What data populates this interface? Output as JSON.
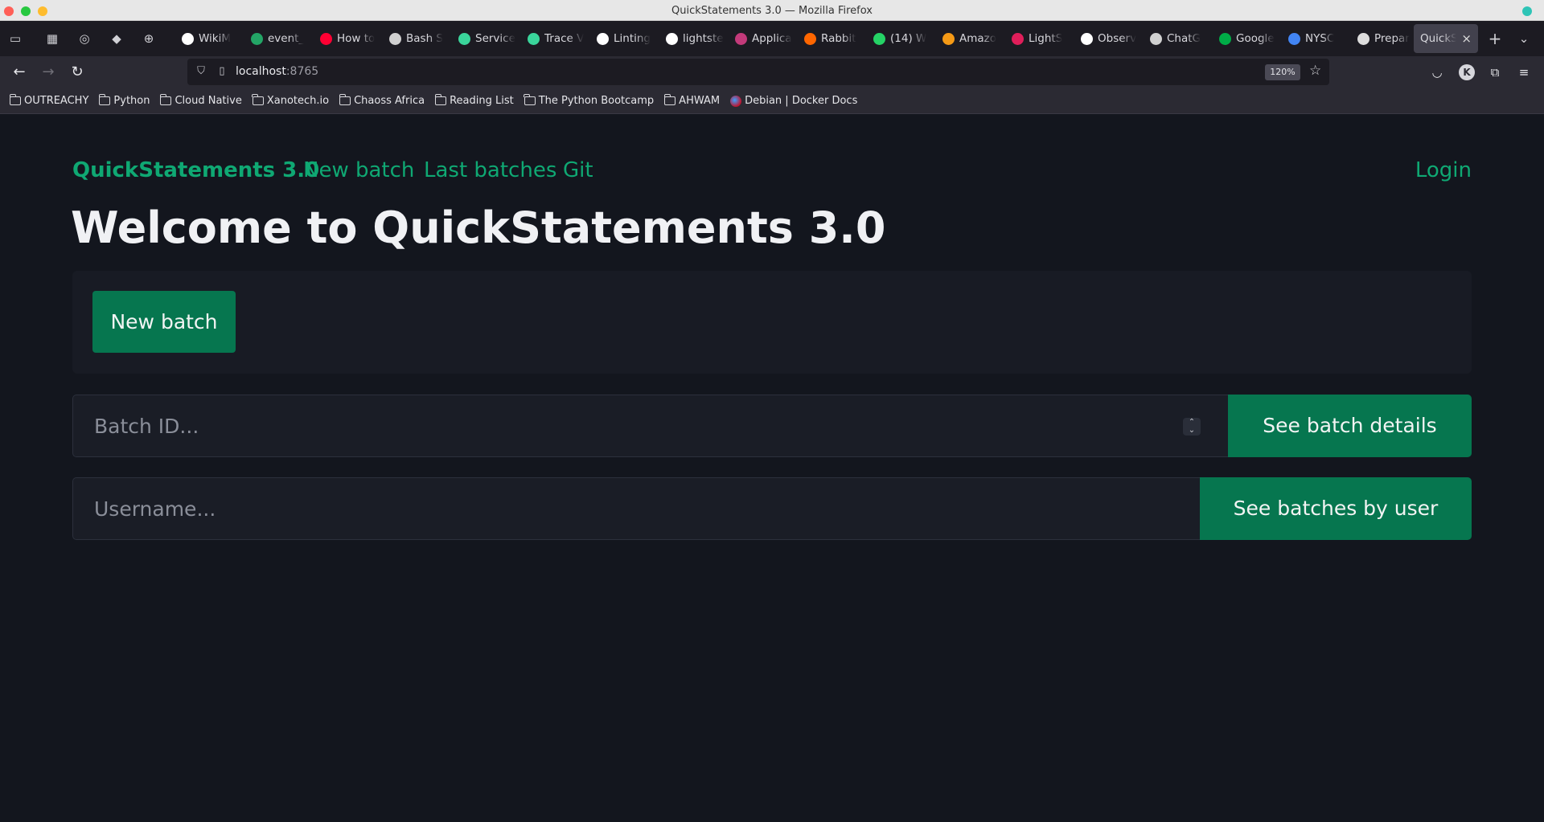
{
  "window": {
    "title": "QuickStatements 3.0 — Mozilla Firefox"
  },
  "tabs": [
    {
      "label": "WikiM",
      "icon": "github-icon",
      "color": "#ffffff"
    },
    {
      "label": "event_",
      "icon": "sheets-icon",
      "color": "#23a566"
    },
    {
      "label": "How to",
      "icon": "youtube-icon",
      "color": "#ff0033"
    },
    {
      "label": "Bash S",
      "icon": "openai-icon",
      "color": "#d0d0d0"
    },
    {
      "label": "Service",
      "icon": "lightstep-icon",
      "color": "#3ad59b"
    },
    {
      "label": "Trace V",
      "icon": "lightstep-icon",
      "color": "#3ad59b"
    },
    {
      "label": "Linting",
      "icon": "git-icon",
      "color": "#ffffff"
    },
    {
      "label": "lightste",
      "icon": "github-icon",
      "color": "#ffffff"
    },
    {
      "label": "Applica",
      "icon": "triangle-icon",
      "color": "#c33a7a"
    },
    {
      "label": "Rabbit",
      "icon": "rabbitmq-icon",
      "color": "#ff6600"
    },
    {
      "label": "(14) W",
      "icon": "whatsapp-icon",
      "color": "#25d366"
    },
    {
      "label": "Amazo",
      "icon": "aws-icon",
      "color": "#f59a16"
    },
    {
      "label": "LightS",
      "icon": "slack-icon",
      "color": "#e01e5a"
    },
    {
      "label": "Observ",
      "icon": "medium-icon",
      "color": "#ffffff"
    },
    {
      "label": "ChatG",
      "icon": "openai-icon",
      "color": "#d0d0d0"
    },
    {
      "label": "Google",
      "icon": "meet-icon",
      "color": "#00ac47"
    },
    {
      "label": "NYSC",
      "icon": "docs-icon",
      "color": "#4285f4"
    },
    {
      "label": "Prepar",
      "icon": "wiki-icon",
      "color": "#dddddd"
    }
  ],
  "active_tab": {
    "label": "QuickSt",
    "close": "×"
  },
  "urlbar": {
    "host": "localhost",
    "port": ":8765",
    "zoom": "120%"
  },
  "bookmarks": [
    {
      "label": "OUTREACHY",
      "icon": "folder-icon"
    },
    {
      "label": "Python",
      "icon": "folder-icon"
    },
    {
      "label": "Cloud Native",
      "icon": "folder-icon"
    },
    {
      "label": "Xanotech.io",
      "icon": "folder-icon"
    },
    {
      "label": "Chaoss Africa",
      "icon": "folder-icon"
    },
    {
      "label": "Reading List",
      "icon": "folder-icon"
    },
    {
      "label": "The Python Bootcamp",
      "icon": "folder-icon"
    },
    {
      "label": "AHWAM",
      "icon": "folder-icon"
    },
    {
      "label": "Debian | Docker Docs",
      "icon": "debian-icon"
    }
  ],
  "nav": {
    "brand": "QuickStatements 3.0",
    "new_batch": "New batch",
    "last_batches": "Last batches",
    "git": "Git",
    "login": "Login"
  },
  "main": {
    "heading": "Welcome to QuickStatements 3.0",
    "new_batch_button": "New batch",
    "batch_id_placeholder": "Batch ID...",
    "batch_details_button": "See batch details",
    "username_placeholder": "Username...",
    "batches_by_user_button": "See batches by user"
  },
  "colors": {
    "accent": "#0fa873",
    "button": "#06764f",
    "background": "#13161e"
  }
}
